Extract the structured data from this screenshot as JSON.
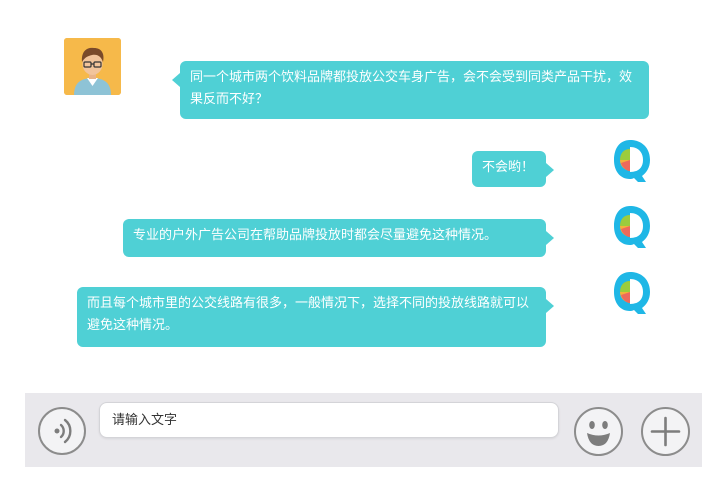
{
  "messages": [
    {
      "sender": "user",
      "text": "同一个城市两个饮料品牌都投放公交车身广告，会不会受到同类产品干扰，效果反而不好？"
    },
    {
      "sender": "bot",
      "text": "不会哟！"
    },
    {
      "sender": "bot",
      "text": "专业的户外广告公司在帮助品牌投放时都会尽量避免这种情况。"
    },
    {
      "sender": "bot",
      "text": "而且每个城市里的公交线路有很多，一般情况下，选择不同的投放线路就可以避免这种情况。"
    }
  ],
  "composer": {
    "placeholder": "请输入文字",
    "voice_icon": "voice-icon",
    "emoji_icon": "smiley-icon",
    "add_icon": "plus-icon"
  },
  "colors": {
    "bubble": "#4fd0d5",
    "bar": "#e9e8ec",
    "avatar_bg": "#f6b94a"
  }
}
